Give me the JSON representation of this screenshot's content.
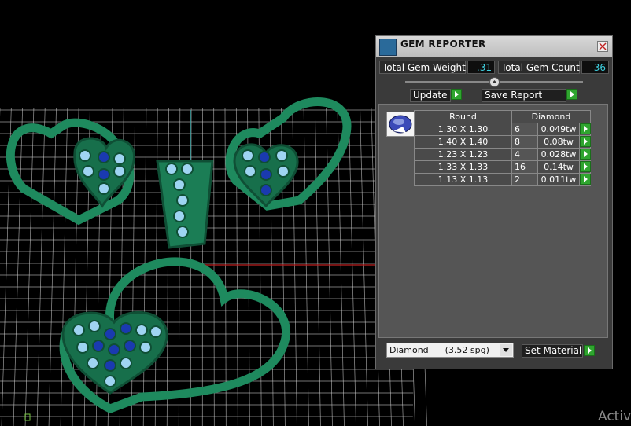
{
  "viewport": {
    "background": "#000000",
    "grid_color": "#cfcfcf",
    "jewelry_color": "#1f8a60"
  },
  "panel": {
    "title": "GEM REPORTER",
    "total_weight_label": "Total Gem Weight",
    "total_weight_value": ".31",
    "total_count_label": "Total Gem Count",
    "total_count_value": "36",
    "update_label": "Update",
    "save_report_label": "Save Report",
    "table": {
      "header_shape": "Round",
      "header_material": "Diamond",
      "rows": [
        {
          "size": "1.30 X 1.30",
          "count": "6",
          "weight": "0.049tw"
        },
        {
          "size": "1.40 X 1.40",
          "count": "8",
          "weight": "0.08tw"
        },
        {
          "size": "1.23 X 1.23",
          "count": "4",
          "weight": "0.028tw"
        },
        {
          "size": "1.33 X 1.33",
          "count": "16",
          "weight": "0.14tw"
        },
        {
          "size": "1.13 X 1.13",
          "count": "2",
          "weight": "0.011tw"
        }
      ]
    },
    "material_select": "Diamond      (3.52 spg)",
    "set_material_label": "Set Material"
  },
  "watermark": "Activ"
}
